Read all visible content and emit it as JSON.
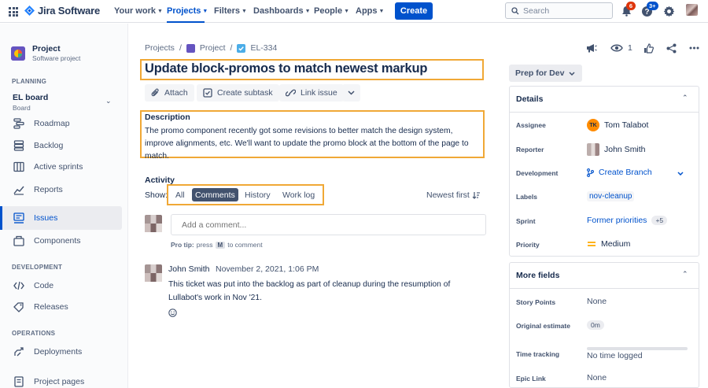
{
  "topnav": {
    "brand": "Jira Software",
    "items": [
      {
        "label": "Your work"
      },
      {
        "label": "Projects"
      },
      {
        "label": "Filters"
      },
      {
        "label": "Dashboards"
      },
      {
        "label": "People"
      },
      {
        "label": "Apps"
      }
    ],
    "create_label": "Create",
    "search_placeholder": "Search",
    "notifications_count": "6",
    "help_count": "3+"
  },
  "sidebar": {
    "project_name": "Project",
    "project_type": "Software project",
    "planning_head": "PLANNING",
    "board_name": "EL board",
    "board_sub": "Board",
    "planning_items": [
      {
        "label": "Roadmap",
        "icon": "roadmap-icon"
      },
      {
        "label": "Backlog",
        "icon": "backlog-icon"
      },
      {
        "label": "Active sprints",
        "icon": "active-sprints-icon"
      },
      {
        "label": "Reports",
        "icon": "reports-icon"
      },
      {
        "label": "Issues",
        "icon": "issues-icon"
      },
      {
        "label": "Components",
        "icon": "components-icon"
      }
    ],
    "development_head": "DEVELOPMENT",
    "development_items": [
      {
        "label": "Code",
        "icon": "code-icon"
      },
      {
        "label": "Releases",
        "icon": "releases-icon"
      }
    ],
    "operations_head": "OPERATIONS",
    "operations_items": [
      {
        "label": "Deployments",
        "icon": "deployments-icon"
      },
      {
        "label": "Project pages",
        "icon": "project-pages-icon"
      }
    ]
  },
  "issue": {
    "breadcrumbs": [
      "Projects",
      "Project",
      "EL-334"
    ],
    "title": "Update block-promos to match newest markup",
    "actions": [
      "Attach",
      "Create subtask",
      "Link issue"
    ],
    "description_head": "Description",
    "description": "The promo component recently got some revisions to better match the design system, improve alignments, etc. We'll want to update the promo block at the bottom of the page to match.",
    "watch_count": "1"
  },
  "activity": {
    "head": "Activity",
    "show_label": "Show:",
    "filters": [
      "All",
      "Comments",
      "History",
      "Work log"
    ],
    "selected_filter": "Comments",
    "sort_label": "Newest first",
    "comment_placeholder": "Add a comment...",
    "protip_prefix": "Pro tip:",
    "protip_press": "press",
    "protip_key": "M",
    "protip_suffix": "to comment",
    "comment": {
      "author": "John Smith",
      "date": "November 2, 2021, 1:06 PM",
      "body": "This ticket was put into the backlog as part of cleanup during the resumption of Lullabot's work in Nov '21."
    }
  },
  "details": {
    "status": "Prep for Dev",
    "head": "Details",
    "fields": {
      "assignee_label": "Assignee",
      "assignee_initials": "TK",
      "assignee": "Tom Talabot",
      "reporter_label": "Reporter",
      "reporter": "John Smith",
      "development_label": "Development",
      "development": "Create Branch",
      "labels_label": "Labels",
      "labels": "nov-cleanup",
      "sprint_label": "Sprint",
      "sprint": "Former priorities",
      "sprint_more": "+5",
      "priority_label": "Priority",
      "priority": "Medium"
    },
    "more_head": "More fields",
    "more": {
      "story_points_label": "Story Points",
      "story_points": "None",
      "original_estimate_label": "Original estimate",
      "original_estimate": "0m",
      "time_tracking_label": "Time tracking",
      "time_tracking": "No time logged",
      "time_tracking_fraction": 0,
      "epic_link_label": "Epic Link",
      "epic_link": "None"
    }
  },
  "colors": {
    "accent": "#0052cc",
    "highlight": "#f0a836",
    "badge_red": "#de350b",
    "priority": "#ffab00"
  }
}
